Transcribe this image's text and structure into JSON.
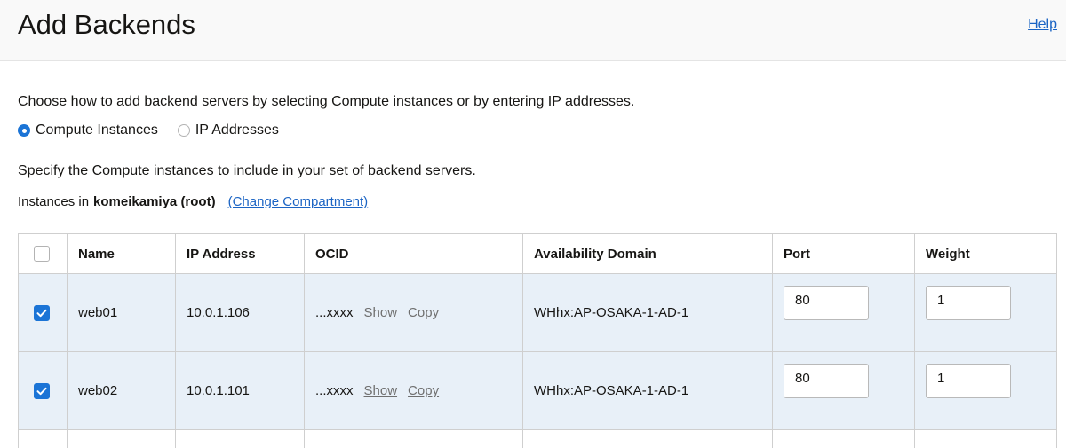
{
  "header": {
    "title": "Add Backends",
    "help_label": "Help"
  },
  "intro": "Choose how to add backend servers by selecting Compute instances or by entering IP addresses.",
  "mode": {
    "options": [
      {
        "label": "Compute Instances",
        "selected": true
      },
      {
        "label": "IP Addresses",
        "selected": false
      }
    ]
  },
  "specify": "Specify the Compute instances to include in your set of backend servers.",
  "instances": {
    "prefix": "Instances in",
    "compartment": "komeikamiya (root)",
    "change_label": "(Change Compartment)"
  },
  "table": {
    "columns": [
      "Name",
      "IP Address",
      "OCID",
      "Availability Domain",
      "Port",
      "Weight"
    ],
    "rows": [
      {
        "checked": true,
        "name": "web01",
        "ip": "10.0.1.106",
        "ocid": "...xxxx",
        "show_label": "Show",
        "copy_label": "Copy",
        "ad": "WHhx:AP-OSAKA-1-AD-1",
        "port": "80",
        "weight": "1"
      },
      {
        "checked": true,
        "name": "web02",
        "ip": "10.0.1.101",
        "ocid": "...xxxx",
        "show_label": "Show",
        "copy_label": "Copy",
        "ad": "WHhx:AP-OSAKA-1-AD-1",
        "port": "80",
        "weight": "1"
      }
    ]
  },
  "colors": {
    "accent": "#1b74d6",
    "link": "#1b64c4",
    "selected_row": "#e8f0f8"
  }
}
